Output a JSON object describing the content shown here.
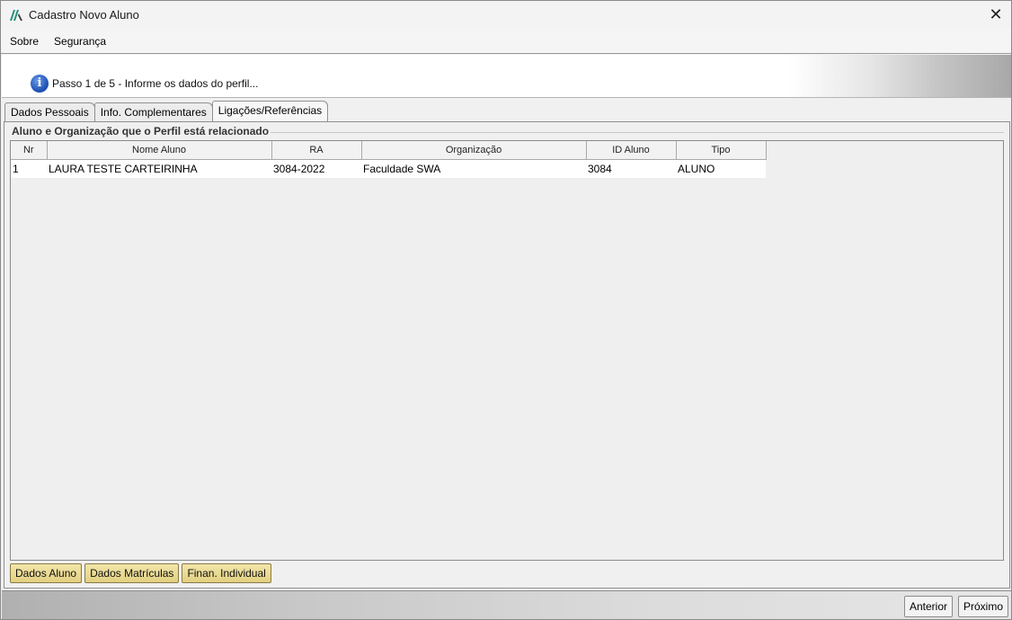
{
  "window": {
    "title": "Cadastro Novo Aluno",
    "close_glyph": "✕"
  },
  "menu": {
    "items": [
      {
        "label": "Sobre"
      },
      {
        "label": "Segurança"
      }
    ]
  },
  "info": {
    "icon_glyph": "i",
    "message": "Passo 1 de 5 - Informe os dados do perfil..."
  },
  "tabs": [
    {
      "label": "Dados Pessoais",
      "active": false
    },
    {
      "label": "Info. Complementares",
      "active": false
    },
    {
      "label": "Ligações/Referências",
      "active": true
    }
  ],
  "group": {
    "title": "Aluno e Organização que o Perfil está relacionado"
  },
  "table": {
    "columns": [
      "Nr",
      "Nome Aluno",
      "RA",
      "Organização",
      "ID Aluno",
      "Tipo"
    ],
    "rows": [
      [
        "1",
        "LAURA TESTE CARTEIRINHA",
        "3084-2022",
        "Faculdade SWA",
        "3084",
        "ALUNO"
      ]
    ]
  },
  "actions": {
    "dados_aluno": "Dados Aluno",
    "dados_matriculas": "Dados Matrículas",
    "finan_individual": "Finan. Individual"
  },
  "navigation": {
    "anterior": "Anterior",
    "proximo": "Próximo"
  },
  "colors": {
    "info_icon": "#2356b8",
    "action_button": "#e8d890",
    "app_icon": "#1f8f7a"
  }
}
